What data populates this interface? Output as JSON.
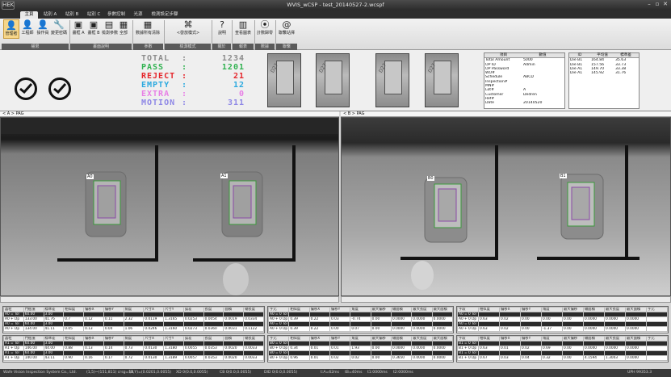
{
  "window": {
    "title": "WVIS_wCSP - test_20140527-2.wcspf",
    "logo": "HEK",
    "controls": [
      "–",
      "▫",
      "✕"
    ]
  },
  "tabs": [
    "主頁",
    "站別 A",
    "站別 B",
    "站別 C",
    "參數控制",
    "光源",
    "檢測設定步驟"
  ],
  "ribbon": {
    "buttons": [
      {
        "label": "管理者",
        "icon": "user-icon"
      },
      {
        "label": "工程師",
        "icon": "user-icon"
      },
      {
        "label": "操作員",
        "icon": "user-icon"
      },
      {
        "label": "變更密碼",
        "icon": "wrench-icon"
      },
      {
        "label": "畫框 A",
        "icon": "frame-icon"
      },
      {
        "label": "畫框 B",
        "icon": "frame-icon"
      },
      {
        "label": "檢測參數",
        "icon": "frame-icon"
      },
      {
        "label": "全部",
        "icon": "frame-icon"
      },
      {
        "label": "數據所有清除",
        "icon": "grid-icon"
      },
      {
        "label": "<發放模式>",
        "icon": "command-icon"
      },
      {
        "label": "說明",
        "icon": "help-icon"
      },
      {
        "label": "查看圖表",
        "icon": "chart-icon"
      },
      {
        "label": "計數歸零",
        "icon": "pin-icon"
      },
      {
        "label": "聯繫站擇",
        "icon": "at-icon"
      }
    ],
    "groups": [
      "權限",
      "畫面說明",
      "參數",
      "檢測模式",
      "關於",
      "報表",
      "數據",
      "聯繫"
    ]
  },
  "stats": [
    {
      "key": "TOTAL",
      "sep": ":",
      "value": "1234",
      "color": "#8c8c8c"
    },
    {
      "key": "PASS",
      "sep": ":",
      "value": "1201",
      "color": "#31b251"
    },
    {
      "key": "REJECT",
      "sep": ":",
      "value": "21",
      "color": "#e5252b"
    },
    {
      "key": "EMPTY",
      "sep": ":",
      "value": "12",
      "color": "#2aa9df"
    },
    {
      "key": "EXTRA",
      "sep": ":",
      "value": "0",
      "color": "#e87fe6"
    },
    {
      "key": "MOTION",
      "sep": ":",
      "value": "311",
      "color": "#8e87e6"
    }
  ],
  "thumbs": [
    "D27",
    "D27",
    "D27",
    "D27"
  ],
  "info": {
    "headers": [
      "項目",
      "數值"
    ],
    "rows": [
      [
        "Total Amount",
        "5000"
      ],
      [
        "OP ID",
        "Admin"
      ],
      [
        "OP Password",
        ""
      ],
      [
        "WO#",
        ""
      ],
      [
        "Schedule",
        "ABCD"
      ],
      [
        "Inspection#",
        ""
      ],
      [
        "MN#",
        ""
      ],
      [
        "Lot#",
        "A"
      ],
      [
        "Customer",
        "Dedren"
      ],
      [
        "Ref#",
        ""
      ],
      [
        "Date",
        "20140520"
      ]
    ]
  },
  "info2": {
    "headers": [
      "ID",
      "平均值",
      "標準差"
    ],
    "rows": [
      [
        "Die B1",
        "164.84",
        "35.63"
      ],
      [
        "Die B1",
        "157.56",
        "33.73"
      ],
      [
        "Die A1",
        "149.70",
        "33.38"
      ],
      [
        "Die A1",
        "145.92",
        "31.76"
      ]
    ]
  },
  "views": [
    {
      "title": "< A > PAG",
      "labels": [
        "A0",
        "A1"
      ]
    },
    {
      "title": "< B > PAG",
      "labels": [
        "B0",
        "B1"
      ]
    }
  ],
  "grids": [
    {
      "headers": [
        "晶粒",
        "門檻值",
        "標準差",
        "相似度",
        "偏移X",
        "偏移Y",
        "角度",
        "尺寸X",
        "尺寸Y",
        "誤差",
        "長度",
        "面積",
        "總長度"
      ],
      "rows": [
        [
          "A0 = Tol",
          "60.00",
          "3.00",
          "",
          "",
          "",
          "",
          "",
          "",
          "",
          "",
          "",
          ""
        ],
        [
          "A0 + Dp",
          "133.00",
          "41.76",
          "0.7",
          "0.12",
          "0.11",
          "2.32",
          "0.0119",
          "1.3165",
          "0.0253",
          "0.0054",
          "0.0019",
          "0.0334"
        ],
        [
          "A0 = Tol",
          "60.00",
          "3.00",
          "",
          "",
          "",
          "",
          "",
          "",
          "",
          "",
          "",
          ""
        ],
        [
          "A0 + Dp",
          "134.00",
          "41.11",
          "0.05",
          "0.13",
          "0.04",
          "1.06",
          "0.0246",
          "1.3160",
          "0.0273",
          "0.0360",
          "0.0031",
          "0.1122"
        ]
      ],
      "rows2": [
        [
          "A1 = Tol",
          "60.00",
          "3.00",
          "",
          "",
          "",
          "",
          "",
          "",
          "",
          "",
          "",
          ""
        ],
        [
          "A1 + Dp",
          "146.00",
          "44.00",
          "0.88",
          "0.13",
          "0.14",
          "0.73",
          "0.0130",
          "1.3180",
          "0.0055",
          "0.0353",
          "0.0020",
          "0.0033"
        ],
        [
          "A1 = Tol",
          "60.00",
          "3.00",
          "",
          "",
          "",
          "",
          "",
          "",
          "",
          "",
          "",
          ""
        ],
        [
          "A1 + Dp",
          "140.00",
          "43.11",
          "0.90",
          "0.16",
          "0.17",
          "0.72",
          "0.0130",
          "1.3189",
          "0.0057",
          "0.0353",
          "0.0020",
          "0.0033"
        ]
      ]
    },
    {
      "headers": [
        "字元",
        "相似度",
        "偏移X",
        "偏移Y",
        "角度",
        "最大偏移",
        "總面積",
        "最大長度",
        "最大面積"
      ],
      "rows": [
        [
          "A0 = 0 Tol",
          "",
          "",
          "",
          "",
          "",
          "",
          "",
          ""
        ],
        [
          "A0 + 0 Dp",
          "0.39",
          "0.22",
          "0.03",
          "-0.74",
          "0.00",
          "0.0000",
          "0.0000",
          "0.0000"
        ],
        [
          "A0 = 0 Tol",
          "",
          "",
          "",
          "",
          "",
          "",
          "",
          ""
        ],
        [
          "A0 + 0 Dp",
          "0.39",
          "0.22",
          "0.00",
          "0.07",
          "0.00",
          "0.0000",
          "0.0000",
          "0.0000"
        ]
      ],
      "rows2": [
        [
          "B0 = 0 Tol",
          "",
          "",
          "",
          "",
          "",
          "",
          "",
          ""
        ],
        [
          "B0 + 0 Dp",
          "0.34",
          "0.01",
          "0.01",
          "1.93",
          "0.00",
          "0.0000",
          "0.0000",
          "0.0000"
        ],
        [
          "B0 = 0 Tol",
          "",
          "",
          "",
          "",
          "",
          "",
          "",
          ""
        ],
        [
          "B0 + 0 Dp",
          "0.96",
          "0.01",
          "0.02",
          "0.02",
          "0.00",
          "0.3650",
          "0.0000",
          "0.0000"
        ]
      ]
    },
    {
      "headers": [
        "字段",
        "相似度",
        "偏移X",
        "偏移Y",
        "角度",
        "最大偏移",
        "總面積",
        "最大長度",
        "最大面積",
        "字元"
      ],
      "rows": [
        [
          "A0 = 0 Tol",
          "",
          "",
          "",
          "",
          "",
          "",
          "",
          "",
          ""
        ],
        [
          "A0 + 0 Dp",
          "0.63",
          "0.02",
          "0.00",
          "0.00",
          "0.00",
          "0.0000",
          "0.0000",
          "0.0000",
          ""
        ],
        [
          "A0 = 0 Tol",
          "",
          "",
          "",
          "",
          "",
          "",
          "",
          "",
          ""
        ],
        [
          "A0 + 0 Dp",
          "0.63",
          "0.02",
          "0.00",
          "-1.37",
          "0.00",
          "0.0000",
          "0.0000",
          "0.0000",
          ""
        ]
      ],
      "rows2": [
        [
          "B1 = 0 Tol",
          "",
          "",
          "",
          "",
          "",
          "",
          "",
          "",
          ""
        ],
        [
          "B1 + 0 Dp",
          "0.63",
          "0.01",
          "0.02",
          "0.69",
          "0.00",
          "0.0000",
          "0.0000",
          "0.0000",
          ""
        ],
        [
          "B1 = 0 Tol",
          "",
          "",
          "",
          "",
          "",
          "",
          "",
          "",
          ""
        ],
        [
          "B1 + 0 Dp",
          "0.67",
          "0.03",
          "0.04",
          "0.32",
          "0.00",
          "4.1594",
          "1.3003",
          "0.0000",
          ""
        ]
      ]
    }
  ],
  "statusbar": [
    "Wafe Vision Inspection System Co., Ltd.",
    "(1,5)~(151,811) crsg=58",
    "(X,Y)=(0.0201,0.0055)",
    "XD 0(0.0,0.0055)",
    "CB 0(0.0,0.0055)",
    "DID 0(0.0,0.0055)",
    "t:A=62ms",
    "tB=40ms",
    "t1:0000ms",
    "t2:0000ms",
    "UPH 99353.3"
  ]
}
